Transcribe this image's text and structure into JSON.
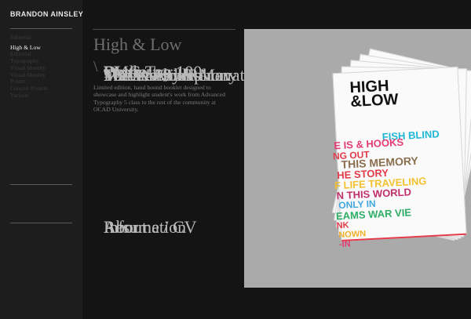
{
  "brand": "BRANDON AINSLEY",
  "nav": {
    "projects": [
      {
        "label": "Work",
        "kind": "title"
      },
      {
        "label": "PMG Top 100",
        "kind": "title"
      },
      {
        "label": "Editorial",
        "kind": "sub"
      },
      {
        "label": "High & Low",
        "kind": "active",
        "gap": true
      },
      {
        "label": "Editorial",
        "kind": "sub"
      },
      {
        "label": "Fish & Hooks",
        "kind": "title",
        "gap": true
      },
      {
        "label": "Typography",
        "kind": "sub"
      },
      {
        "label": "Toronto Symphony",
        "kind": "title",
        "gap": true
      },
      {
        "label": "Orchestra",
        "kind": "title"
      },
      {
        "label": "Visual Identity",
        "kind": "sub"
      },
      {
        "label": "FB Custom Renovations",
        "kind": "title",
        "gap": true
      },
      {
        "label": "Visual Identity",
        "kind": "sub"
      },
      {
        "label": "The Invisible Man",
        "kind": "title",
        "gap": true
      },
      {
        "label": "Poster",
        "kind": "sub"
      },
      {
        "label": "The Wasbills",
        "kind": "title",
        "gap": true
      },
      {
        "label": "Concert Posters",
        "kind": "sub"
      },
      {
        "label": "Marks",
        "kind": "title",
        "gap": true
      },
      {
        "label": "Various",
        "kind": "sub"
      }
    ],
    "secondary": [
      {
        "label": "About"
      },
      {
        "label": "Information"
      },
      {
        "label": "Resume / CV"
      }
    ]
  },
  "project": {
    "title": "High & Low",
    "separator": "\\",
    "description": "Limited edition, hand bound booklet designed to showcase and highlight student's work from Advanced Typography 5 class to the rest of the community at OCAD University."
  },
  "cover": {
    "title_line1": "HIGH",
    "title_line2": "&LOW",
    "words": [
      {
        "text": "FISH  BLIND",
        "color": "#1fb7d6"
      },
      {
        "text": "E IS  & HOOKS",
        "color": "#e23b74"
      },
      {
        "text": "NG OUT",
        "color": "#e23b4a"
      },
      {
        "text": "THIS  MEMORY",
        "color": "#8a6f4e"
      },
      {
        "text": "HE STORY",
        "color": "#e23b4a"
      },
      {
        "text": "F LIFE  TRAVELING",
        "color": "#f2c230"
      },
      {
        "text": "N THIS WORLD",
        "color": "#c0306b"
      },
      {
        "text": "ONLY IN",
        "color": "#3ea6e0"
      },
      {
        "text": "EAMS  WAR VIE",
        "color": "#2fae68"
      },
      {
        "text": "NK",
        "color": "#e23b4a"
      },
      {
        "text": "NOWN",
        "color": "#f0b22b"
      },
      {
        "text": "-IN",
        "color": "#e2407b"
      }
    ]
  }
}
